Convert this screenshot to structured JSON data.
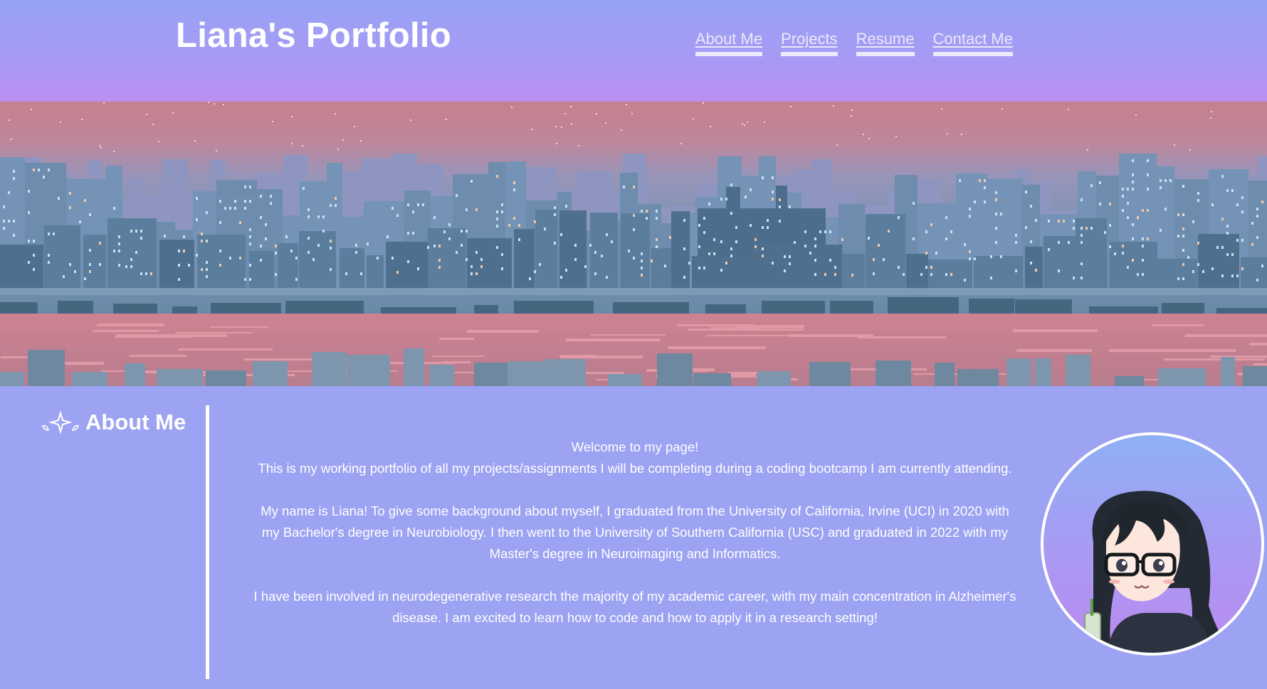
{
  "header": {
    "title": "Liana's Portfolio",
    "nav": [
      {
        "label": "About Me"
      },
      {
        "label": "Projects"
      },
      {
        "label": "Resume"
      },
      {
        "label": "Contact Me"
      }
    ]
  },
  "banner": {
    "description_icon": "pixel-city-skyline-image"
  },
  "about": {
    "heading": "About Me",
    "heading_icon": "sparkle-icon",
    "welcome": "Welcome to my page!",
    "intro": "This is my working portfolio of all my projects/assignments I will be completing during a coding bootcamp I am currently attending.",
    "background": "My name is Liana! To give some background about myself, I graduated from the University of California, Irvine (UCI) in 2020 with my Bachelor's degree in Neurobiology. I then went to the University of Southern California (USC) and graduated in 2022 with my Master's degree in Neuroimaging and Informatics.",
    "research": "I have been involved in neurodegenerative research the majority of my academic career, with my main concentration in Alzheimer's disease. I am excited to learn how to code and how to apply it in a research setting!"
  },
  "colors": {
    "page_bg": "#9ba3f2",
    "header_top": "#97a3f5",
    "header_bottom": "#bb8ff1",
    "text": "#ffffff"
  }
}
